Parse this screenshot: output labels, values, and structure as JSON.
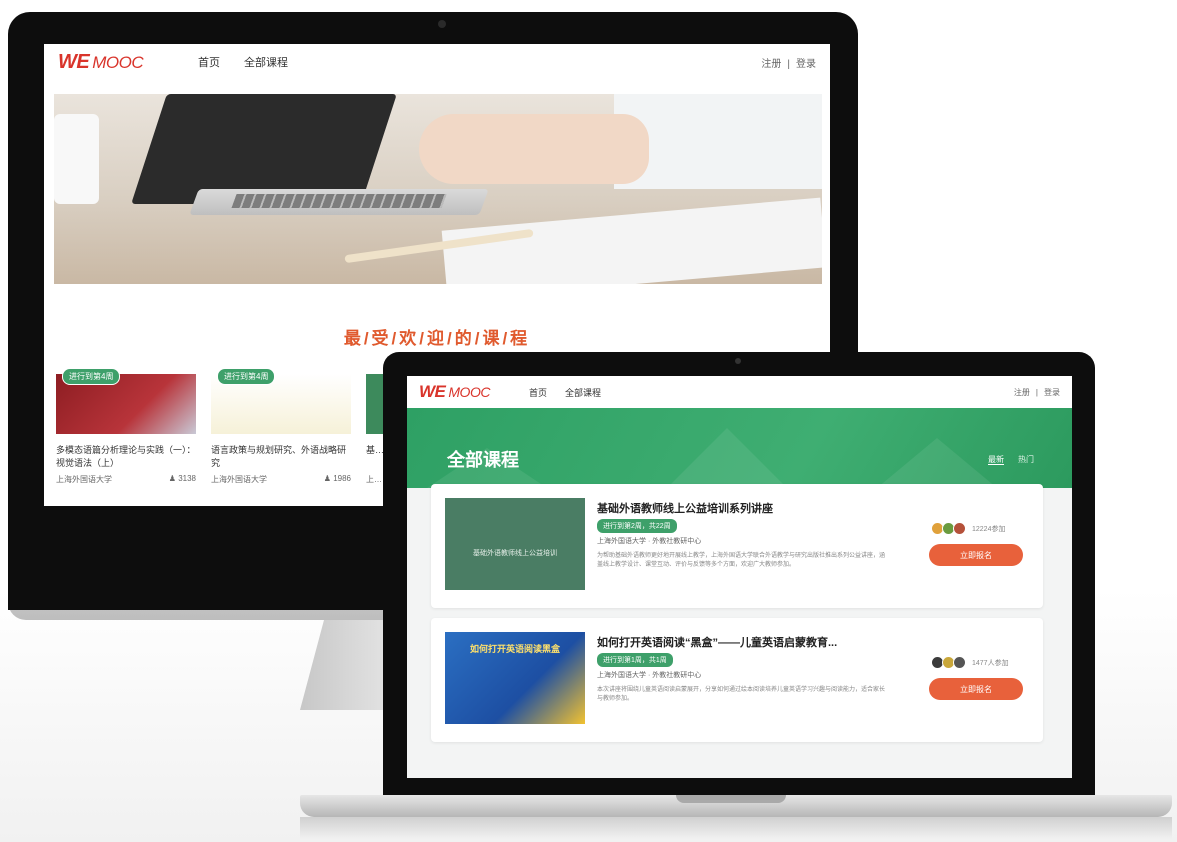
{
  "desktop": {
    "brand": {
      "we": "WE",
      "mooc": "MOOC"
    },
    "nav": {
      "home": "首页",
      "all_courses": "全部课程"
    },
    "auth": {
      "register": "注册",
      "separator": "|",
      "login": "登录"
    },
    "section_title": "最/受/欢/迎/的/课/程",
    "cards": [
      {
        "badge": "进行到第4周",
        "title": "多模态语篇分析理论与实践（一）：视觉语法（上）",
        "school": "上海外国语大学",
        "count": "3138"
      },
      {
        "badge": "进行到第4周",
        "title": "语言政策与规划研究、外语战略研究",
        "school": "上海外国语大学",
        "count": "1986"
      },
      {
        "badge": "",
        "title": "基…",
        "school": "上…",
        "count": ""
      }
    ]
  },
  "laptop": {
    "brand": {
      "we": "WE",
      "mooc": "MOOC"
    },
    "nav": {
      "home": "首页",
      "all_courses": "全部课程"
    },
    "auth": {
      "register": "注册",
      "separator": "|",
      "login": "登录"
    },
    "banner_title": "全部课程",
    "sort": {
      "latest": "最新",
      "hot": "热门"
    },
    "courses": [
      {
        "title": "基础外语教师线上公益培训系列讲座",
        "thumb_text": "基础外语教师线上公益培训",
        "status": "进行到第2周，共22周",
        "school": "上海外国语大学 · 外教社教研中心",
        "desc": "为帮助基础外语教师更好地开展线上教学，上海外国语大学联合外语教学与研究出版社推出系列公益讲座，涵盖线上教学设计、课堂互动、评价与反馈等多个方面，欢迎广大教师参加。",
        "enrolled": "12224参加",
        "button": "立即报名"
      },
      {
        "title": "如何打开英语阅读“黑盒”——儿童英语启蒙教育...",
        "thumb_text": "如何打开英语阅读黑盒",
        "status": "进行到第1周，共1周",
        "school": "上海外国语大学 · 外教社教研中心",
        "desc": "本次讲座将围绕儿童英语阅读启蒙展开，分享如何通过绘本阅读培养儿童英语学习兴趣与阅读能力，适合家长与教师参加。",
        "enrolled": "1477人参加",
        "button": "立即报名"
      }
    ]
  }
}
